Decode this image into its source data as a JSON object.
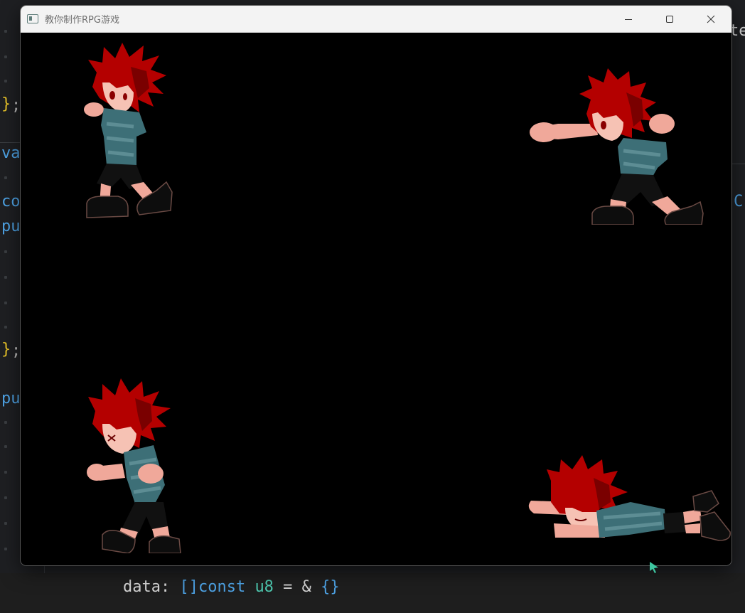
{
  "window": {
    "title": "教你制作RPG游戏",
    "buttons": [
      "minimize",
      "maximize",
      "close"
    ]
  },
  "editor_background": {
    "fragments": [
      {
        "text": "}",
        "cls": "c-brace"
      },
      {
        "text": ";",
        "cls": "c-semi"
      },
      {
        "text": "va",
        "cls": "c-kw"
      },
      {
        "text": "co",
        "cls": "c-kw"
      },
      {
        "text": "pu",
        "cls": "c-kw"
      },
      {
        "text": "}",
        "cls": "c-brace"
      },
      {
        "text": ";",
        "cls": "c-semi"
      },
      {
        "text": "pu",
        "cls": "c-kw"
      },
      {
        "text": "te",
        "cls": "c-plain"
      },
      {
        "text": "C",
        "cls": "c-kw"
      }
    ],
    "bottom_line": "data: []const u8 = & {}",
    "bottom_tokens": [
      {
        "text": "data",
        "cls": "c-plain"
      },
      {
        "text": ": ",
        "cls": "c-plain"
      },
      {
        "text": "[]const",
        "cls": "c-kw"
      },
      {
        "text": " ",
        "cls": "c-plain"
      },
      {
        "text": "u8",
        "cls": "c-type"
      },
      {
        "text": " = & ",
        "cls": "c-plain"
      },
      {
        "text": "{}",
        "cls": "c-kw"
      }
    ]
  },
  "sprites": [
    {
      "name": "player-sprite-idle",
      "pose": "idle"
    },
    {
      "name": "player-sprite-punch",
      "pose": "punch"
    },
    {
      "name": "player-sprite-hurt",
      "pose": "hurt"
    },
    {
      "name": "player-sprite-knocked-down",
      "pose": "down"
    }
  ],
  "colors": {
    "hair": "#b40000",
    "hair_dark": "#7a0000",
    "skin": "#f0a89a",
    "shirt": "#3d6f77",
    "shorts": "#111111",
    "shoes": "#0d0d0d"
  }
}
